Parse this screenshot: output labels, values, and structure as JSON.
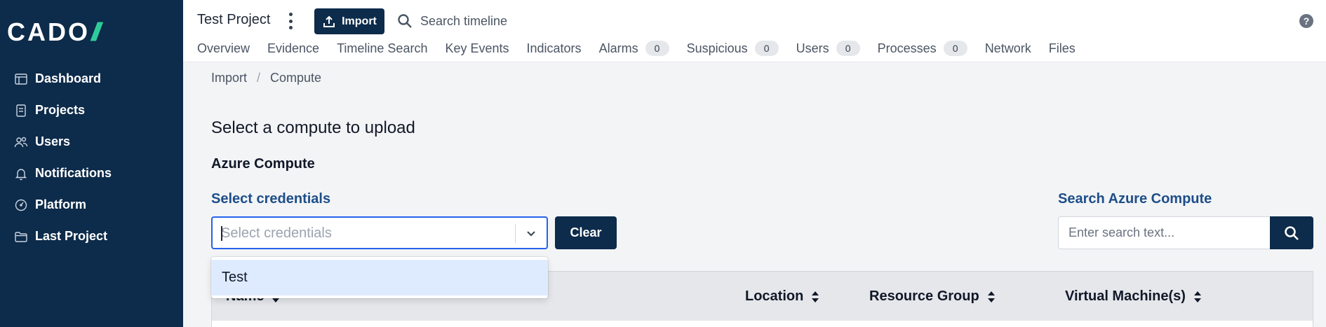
{
  "sidebar": {
    "logo_text": "CADO",
    "logo_accent": "//",
    "items": [
      {
        "label": "Dashboard",
        "icon": "dashboard-icon"
      },
      {
        "label": "Projects",
        "icon": "projects-icon"
      },
      {
        "label": "Users",
        "icon": "users-icon"
      },
      {
        "label": "Notifications",
        "icon": "bell-icon"
      },
      {
        "label": "Platform",
        "icon": "platform-icon"
      },
      {
        "label": "Last Project",
        "icon": "folder-icon"
      }
    ]
  },
  "header": {
    "project_title": "Test Project",
    "import_label": "Import",
    "search_placeholder": "Search timeline",
    "help_label": "?",
    "tabs": [
      {
        "label": "Overview"
      },
      {
        "label": "Evidence"
      },
      {
        "label": "Timeline Search"
      },
      {
        "label": "Key Events"
      },
      {
        "label": "Indicators"
      },
      {
        "label": "Alarms",
        "count": "0"
      },
      {
        "label": "Suspicious",
        "count": "0"
      },
      {
        "label": "Users",
        "count": "0"
      },
      {
        "label": "Processes",
        "count": "0"
      },
      {
        "label": "Network"
      },
      {
        "label": "Files"
      }
    ]
  },
  "breadcrumb": {
    "items": [
      "Import",
      "Compute"
    ],
    "separator": "/"
  },
  "main": {
    "heading": "Select a compute to upload",
    "section": "Azure Compute",
    "credentials_label": "Select credentials",
    "credentials_placeholder": "Select credentials",
    "clear_label": "Clear",
    "search_label": "Search Azure Compute",
    "search_placeholder": "Enter search text...",
    "dropdown_options": [
      "Test"
    ],
    "table_columns": [
      "Name",
      "Location",
      "Resource Group",
      "Virtual Machine(s)"
    ]
  },
  "colors": {
    "sidebar_bg": "#0d2b4a",
    "accent": "#2ecc9a",
    "label_blue": "#1d4e89",
    "option_highlight": "#deebff"
  }
}
